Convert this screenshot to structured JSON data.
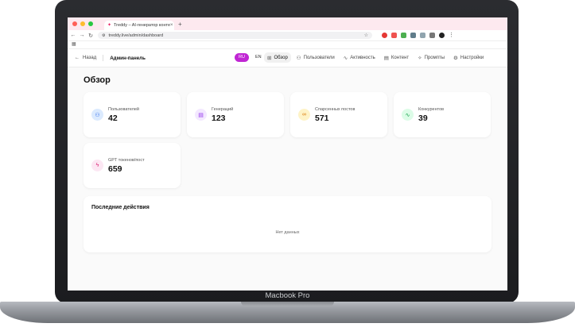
{
  "device": {
    "model": "Macbook Pro"
  },
  "browser": {
    "tab_title": "Treddy – AI-генератор конте",
    "url": "treddy.live/admin/dashboard"
  },
  "nav": {
    "back_label": "Назад",
    "title": "Админ-панель",
    "langs": [
      "RU",
      "EN"
    ],
    "active_lang": "RU",
    "menu": [
      {
        "label": "Обзор",
        "icon": "grid-icon"
      },
      {
        "label": "Пользователи",
        "icon": "users-icon"
      },
      {
        "label": "Активность",
        "icon": "activity-icon"
      },
      {
        "label": "Контент",
        "icon": "document-icon"
      },
      {
        "label": "Промпты",
        "icon": "sparkle-icon"
      },
      {
        "label": "Настройки",
        "icon": "gear-icon"
      }
    ]
  },
  "dashboard": {
    "title": "Обзор",
    "stats": [
      {
        "label": "Пользователей",
        "value": "42",
        "icon": "users-icon",
        "color": "#dbeafe",
        "icon_color": "#2563eb"
      },
      {
        "label": "Генераций",
        "value": "123",
        "icon": "document-icon",
        "color": "#f3e8ff",
        "icon_color": "#9333ea"
      },
      {
        "label": "Спарсенных постов",
        "value": "571",
        "icon": "link-icon",
        "color": "#fef3c7",
        "icon_color": "#d97706"
      },
      {
        "label": "Конкурентов",
        "value": "39",
        "icon": "activity-icon",
        "color": "#dcfce7",
        "icon_color": "#16a34a"
      },
      {
        "label": "GPT токенов/пост",
        "value": "659",
        "icon": "zap-icon",
        "color": "#fce7f3",
        "icon_color": "#db2777"
      }
    ],
    "recent": {
      "title": "Последние действия",
      "empty": "Нет данных"
    }
  },
  "colors": {
    "accent": "#c026d3",
    "tabbar": "#fde9ef"
  }
}
